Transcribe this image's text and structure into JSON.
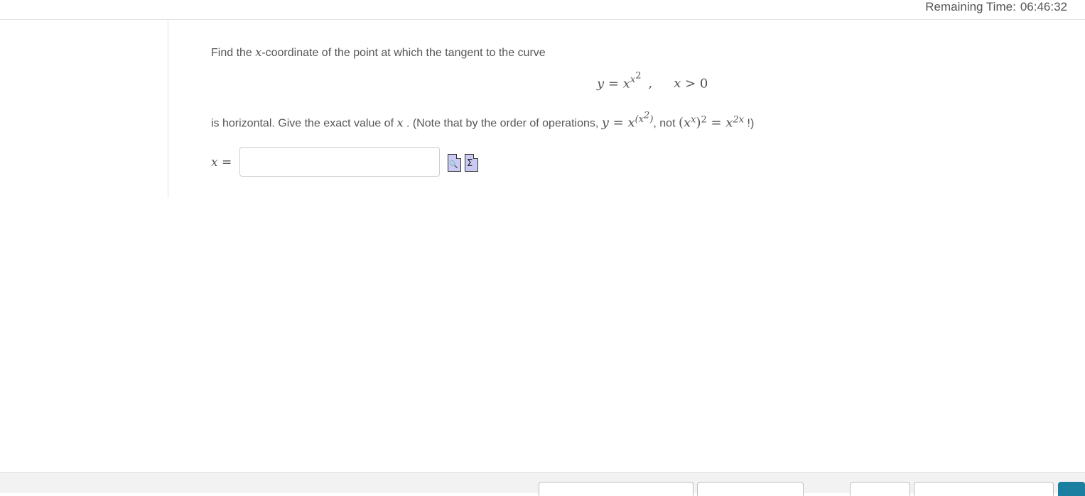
{
  "header": {
    "timer_label": "Remaining Time:",
    "timer_value": "06:46:32"
  },
  "question": {
    "intro_before": "Find the ",
    "intro_var": "x",
    "intro_after": "-coordinate of the point at which the tangent to the curve",
    "display_y": "y",
    "display_eq": " = ",
    "display_base": "x",
    "display_exp_base": "x",
    "display_exp_power": "2",
    "display_comma": ",",
    "display_cond_var": "x",
    "display_cond_rest": " > 0",
    "line2_before": "is horizontal. Give the exact value of ",
    "line2_var": "x",
    "line2_mid": " .  (Note that by the order of operations, ",
    "note_y": "y",
    "note_eq": " = ",
    "note_x": "x",
    "note_exp": "(x",
    "note_exp_pow": "2",
    "note_exp_close": ")",
    "note_not": ", not ",
    "note_paren_open": "(",
    "note_px": "x",
    "note_px_exp": "x",
    "note_paren_close": ")",
    "note_sq": "2",
    "note_eq2": " = ",
    "note_x2": "x",
    "note_x2_exp": "2x",
    "note_end": " !)"
  },
  "answer": {
    "label_var": "x",
    "label_eq": " =",
    "value": "",
    "placeholder": ""
  },
  "tools": {
    "preview_icon": "preview-magnifier-icon",
    "equation_icon": "equation-sigma-icon",
    "preview_glyph": "🔍",
    "equation_glyph": "Σ"
  },
  "footer": {
    "buttons": [
      "",
      "",
      "",
      "",
      ""
    ]
  },
  "colors": {
    "text": "#555555",
    "rule": "#e2e2e2",
    "tool_fill": "#c9c9f2",
    "primary": "#1a7fa0"
  }
}
